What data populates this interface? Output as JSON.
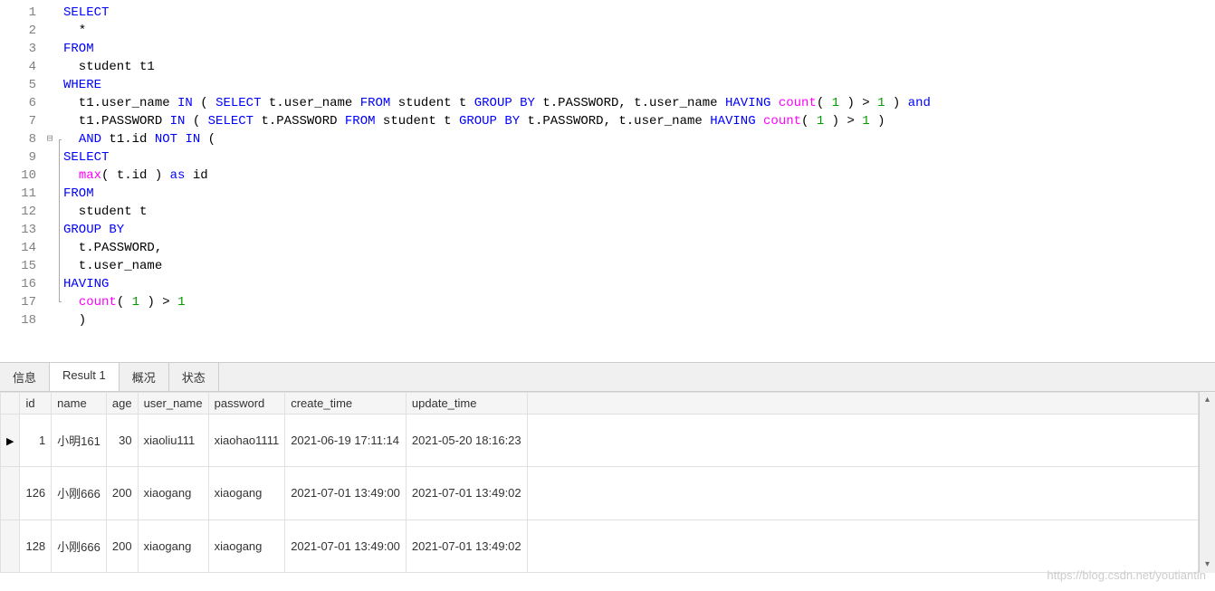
{
  "code": {
    "lines": [
      {
        "n": 1,
        "fold": "",
        "bracket": "",
        "tokens": [
          [
            "kw",
            "SELECT"
          ]
        ]
      },
      {
        "n": 2,
        "fold": "",
        "bracket": "",
        "tokens": [
          [
            "ident",
            "  *"
          ]
        ]
      },
      {
        "n": 3,
        "fold": "",
        "bracket": "",
        "tokens": [
          [
            "kw",
            "FROM"
          ]
        ]
      },
      {
        "n": 4,
        "fold": "",
        "bracket": "",
        "tokens": [
          [
            "ident",
            "  student t1 "
          ]
        ]
      },
      {
        "n": 5,
        "fold": "",
        "bracket": "",
        "tokens": [
          [
            "kw",
            "WHERE"
          ]
        ]
      },
      {
        "n": 6,
        "fold": "",
        "bracket": "",
        "tokens": [
          [
            "ident",
            "  t1.user_name "
          ],
          [
            "kw",
            "IN"
          ],
          [
            "ident",
            " ( "
          ],
          [
            "kw",
            "SELECT"
          ],
          [
            "ident",
            " t.user_name "
          ],
          [
            "kw",
            "FROM"
          ],
          [
            "ident",
            " student t "
          ],
          [
            "kw",
            "GROUP BY"
          ],
          [
            "ident",
            " t.PASSWORD, t.user_name "
          ],
          [
            "kw",
            "HAVING"
          ],
          [
            "ident",
            " "
          ],
          [
            "fn",
            "count"
          ],
          [
            "ident",
            "( "
          ],
          [
            "num",
            "1"
          ],
          [
            "ident",
            " ) > "
          ],
          [
            "num",
            "1"
          ],
          [
            "ident",
            " ) "
          ],
          [
            "kw",
            "and"
          ]
        ]
      },
      {
        "n": 7,
        "fold": "",
        "bracket": "",
        "tokens": [
          [
            "ident",
            "  t1.PASSWORD "
          ],
          [
            "kw",
            "IN"
          ],
          [
            "ident",
            " ( "
          ],
          [
            "kw",
            "SELECT"
          ],
          [
            "ident",
            " t.PASSWORD "
          ],
          [
            "kw",
            "FROM"
          ],
          [
            "ident",
            " student t "
          ],
          [
            "kw",
            "GROUP BY"
          ],
          [
            "ident",
            " t.PASSWORD, t.user_name "
          ],
          [
            "kw",
            "HAVING"
          ],
          [
            "ident",
            " "
          ],
          [
            "fn",
            "count"
          ],
          [
            "ident",
            "( "
          ],
          [
            "num",
            "1"
          ],
          [
            "ident",
            " ) > "
          ],
          [
            "num",
            "1"
          ],
          [
            "ident",
            " ) "
          ]
        ]
      },
      {
        "n": 8,
        "fold": "⊟",
        "bracket": "start",
        "tokens": [
          [
            "ident",
            "  "
          ],
          [
            "kw",
            "AND"
          ],
          [
            "ident",
            " t1.id "
          ],
          [
            "kw",
            "NOT IN"
          ],
          [
            "ident",
            " ("
          ]
        ]
      },
      {
        "n": 9,
        "fold": "",
        "bracket": "mid",
        "tokens": [
          [
            "kw",
            "SELECT"
          ]
        ]
      },
      {
        "n": 10,
        "fold": "",
        "bracket": "mid",
        "tokens": [
          [
            "ident",
            "  "
          ],
          [
            "fn",
            "max"
          ],
          [
            "ident",
            "( t.id ) "
          ],
          [
            "kw",
            "as"
          ],
          [
            "ident",
            " id "
          ]
        ]
      },
      {
        "n": 11,
        "fold": "",
        "bracket": "mid",
        "tokens": [
          [
            "kw",
            "FROM"
          ]
        ]
      },
      {
        "n": 12,
        "fold": "",
        "bracket": "mid",
        "tokens": [
          [
            "ident",
            "  student t "
          ]
        ]
      },
      {
        "n": 13,
        "fold": "",
        "bracket": "mid",
        "tokens": [
          [
            "kw",
            "GROUP BY"
          ]
        ]
      },
      {
        "n": 14,
        "fold": "",
        "bracket": "mid",
        "tokens": [
          [
            "ident",
            "  t.PASSWORD,"
          ]
        ]
      },
      {
        "n": 15,
        "fold": "",
        "bracket": "mid",
        "tokens": [
          [
            "ident",
            "  t.user_name "
          ]
        ]
      },
      {
        "n": 16,
        "fold": "",
        "bracket": "mid",
        "tokens": [
          [
            "kw",
            "HAVING"
          ]
        ]
      },
      {
        "n": 17,
        "fold": "",
        "bracket": "end",
        "tokens": [
          [
            "ident",
            "  "
          ],
          [
            "fn",
            "count"
          ],
          [
            "ident",
            "( "
          ],
          [
            "num",
            "1"
          ],
          [
            "ident",
            " ) > "
          ],
          [
            "num",
            "1"
          ],
          [
            "ident",
            " "
          ]
        ]
      },
      {
        "n": 18,
        "fold": "",
        "bracket": "",
        "tokens": [
          [
            "ident",
            "  )"
          ]
        ]
      }
    ]
  },
  "tabs": {
    "items": [
      {
        "id": "info",
        "label": "信息",
        "active": false
      },
      {
        "id": "result1",
        "label": "Result 1",
        "active": true
      },
      {
        "id": "profile",
        "label": "概况",
        "active": false
      },
      {
        "id": "status",
        "label": "状态",
        "active": false
      }
    ]
  },
  "results": {
    "columns": [
      "id",
      "name",
      "age",
      "user_name",
      "password",
      "create_time",
      "update_time"
    ],
    "rows": [
      {
        "current": true,
        "cells": [
          "1",
          "小明161",
          "30",
          "xiaoliu111",
          "xiaohao1111",
          "2021-06-19 17:11:14",
          "2021-05-20 18:16:23"
        ]
      },
      {
        "current": false,
        "cells": [
          "126",
          "小刚666",
          "200",
          "xiaogang",
          "xiaogang",
          "2021-07-01 13:49:00",
          "2021-07-01 13:49:02"
        ]
      },
      {
        "current": false,
        "cells": [
          "128",
          "小刚666",
          "200",
          "xiaogang",
          "xiaogang",
          "2021-07-01 13:49:00",
          "2021-07-01 13:49:02"
        ]
      }
    ]
  },
  "watermark": "https://blog.csdn.net/youtiantin"
}
